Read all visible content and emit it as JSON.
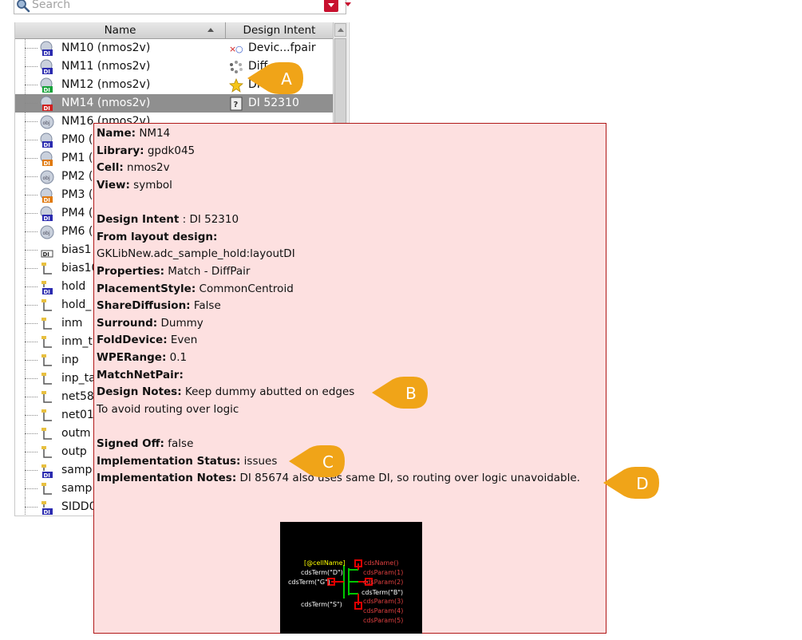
{
  "search": {
    "placeholder": "Search"
  },
  "columns": {
    "name": "Name",
    "design_intent": "Design Intent"
  },
  "rows": [
    {
      "name": "NM10 (nmos2v)",
      "intent": "Devic...fpair",
      "icon": "instance-di-blue",
      "intent_icon": "device-pair-icon"
    },
    {
      "name": "NM11 (nmos2v)",
      "intent": "Diff",
      "icon": "instance-di-blue",
      "intent_icon": "spinner-icon"
    },
    {
      "name": "NM12 (nmos2v)",
      "intent": "DI",
      "icon": "instance-di-green",
      "intent_icon": "star-icon"
    },
    {
      "name": "NM14 (nmos2v)",
      "intent": "DI 52310",
      "icon": "instance-di-red",
      "intent_icon": "note-icon",
      "selected": true
    },
    {
      "name": "NM16 (nmos2v)",
      "intent": "",
      "icon": "instance-obj",
      "intent_icon": ""
    },
    {
      "name": "PM0 (",
      "icon": "instance-di-blue"
    },
    {
      "name": "PM1 (",
      "icon": "instance-di-orange"
    },
    {
      "name": "PM2 (",
      "icon": "instance-obj"
    },
    {
      "name": "PM3 (",
      "icon": "instance-di-orange"
    },
    {
      "name": "PM4 (",
      "icon": "instance-di-blue"
    },
    {
      "name": "PM6 (",
      "icon": "instance-obj"
    },
    {
      "name": "bias1",
      "icon": "di-tag"
    },
    {
      "name": "bias10",
      "icon": "pin"
    },
    {
      "name": "hold",
      "icon": "pin-di"
    },
    {
      "name": "hold_",
      "icon": "pin"
    },
    {
      "name": "inm",
      "icon": "pin"
    },
    {
      "name": "inm_t",
      "icon": "pin"
    },
    {
      "name": "inp",
      "icon": "pin"
    },
    {
      "name": "inp_ta",
      "icon": "pin"
    },
    {
      "name": "net58",
      "icon": "pin"
    },
    {
      "name": "net01",
      "icon": "pin"
    },
    {
      "name": "outm",
      "icon": "pin"
    },
    {
      "name": "outp",
      "icon": "pin"
    },
    {
      "name": "samp",
      "icon": "pin-di"
    },
    {
      "name": "samp",
      "icon": "pin"
    },
    {
      "name": "SIDD0",
      "icon": "pin-di"
    }
  ],
  "tooltip": {
    "name_label": "Name:",
    "name_value": " NM14",
    "library_label": "Library:",
    "library_value": " gpdk045",
    "cell_label": "Cell:",
    "cell_value": " nmos2v",
    "view_label": "View:",
    "view_value": " symbol",
    "intent_label": "Design Intent",
    "intent_value": " : DI 52310",
    "from_label": "From layout design:",
    "from_value": "GKLibNew.adc_sample_hold:layoutDI",
    "properties_label": "Properties:",
    "properties_value": " Match - DiffPair",
    "placement_label": "PlacementStyle:",
    "placement_value": " CommonCentroid",
    "share_label": "ShareDiffusion:",
    "share_value": " False",
    "surround_label": "Surround:",
    "surround_value": " Dummy",
    "fold_label": "FoldDevice:",
    "fold_value": " Even",
    "wpe_label": "WPERange:",
    "wpe_value": " 0.1",
    "matchnet_label": "MatchNetPair:",
    "notes_label": "Design Notes:",
    "notes_value": " Keep dummy abutted on edges",
    "notes_line2": "To avoid routing over logic",
    "signed_label": "Signed Off:",
    "signed_value": " false",
    "impl_status_label": "Implementation Status:",
    "impl_status_value": " issues",
    "impl_notes_label": "Implementation Notes:",
    "impl_notes_value": " DI 85674 also uses same DI, so routing over logic unavoidable."
  },
  "symbol": {
    "cell_name": "[@cellName]",
    "inst_name": "cdsName()",
    "term_d": "cdsTerm(\"D\")",
    "term_g": "cdsTerm(\"G\")",
    "term_b": "cdsTerm(\"B\")",
    "term_s": "cdsTerm(\"S\")",
    "param1": "cdsParam(1)",
    "param2": "cdsParam(2)",
    "param3": "cdsParam(3)",
    "param4": "cdsParam(4)",
    "param5": "cdsParam(5)"
  },
  "callouts": {
    "a": "A",
    "b": "B",
    "c": "C",
    "d": "D"
  },
  "colors": {
    "callout": "#f0a418",
    "tooltip_bg": "#fde0e0",
    "tooltip_border": "#b01818",
    "selected_row": "#8f8f8f"
  }
}
